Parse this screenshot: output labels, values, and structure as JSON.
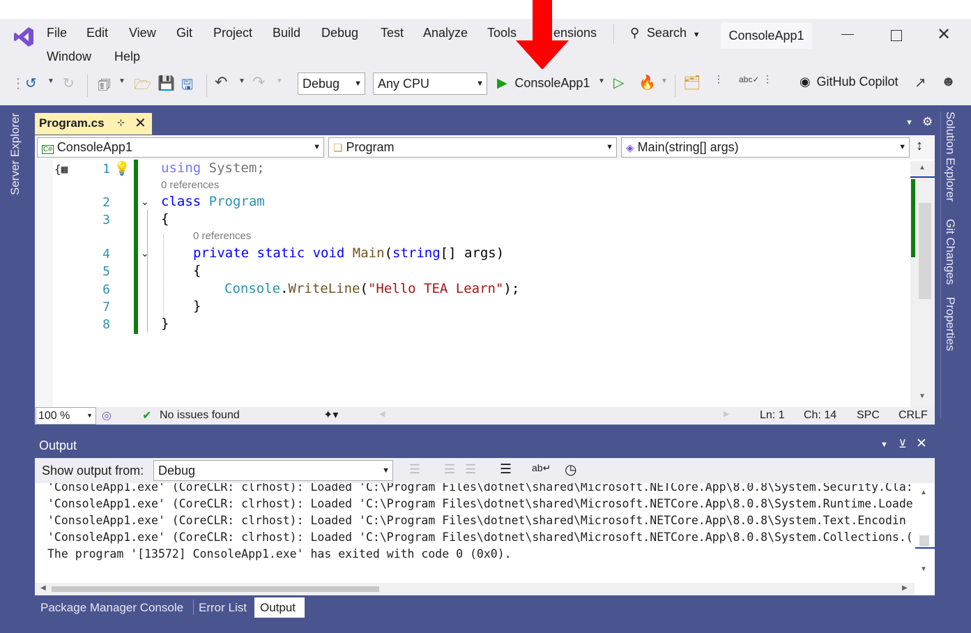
{
  "menu": {
    "items": [
      "File",
      "Edit",
      "View",
      "Git",
      "Project",
      "Build",
      "Debug",
      "Test",
      "Analyze",
      "Tools",
      "ensions",
      "Window",
      "Help"
    ],
    "search_label": "Search",
    "project_badge": "ConsoleApp1"
  },
  "toolbar": {
    "config": "Debug",
    "platform": "Any CPU",
    "run_target": "ConsoleApp1",
    "copilot": "GitHub Copilot"
  },
  "side_tabs": {
    "left": "Server Explorer",
    "right": [
      "Solution Explorer",
      "Git Changes",
      "Properties"
    ]
  },
  "editor": {
    "tab_title": "Program.cs",
    "nav_project": "ConsoleApp1",
    "nav_class": "Program",
    "nav_member": "Main(string[] args)",
    "line_numbers": [
      "1",
      "2",
      "3",
      "4",
      "5",
      "6",
      "7",
      "8"
    ],
    "refs_label": "0 references",
    "code": {
      "l1_kw": "using",
      "l1_rest": " System;",
      "l2_kw": "class",
      "l2_name": "Program",
      "l3": "{",
      "l4_kw": "private static void",
      "l4_fn": "Main",
      "l4_open": "(",
      "l4_kw2": "string",
      "l4_rest": "[] args)",
      "l5": "{",
      "l6_type": "Console",
      "l6_dot": ".",
      "l6_fn": "WriteLine",
      "l6_open": "(",
      "l6_str": "\"Hello TEA Learn\"",
      "l6_close": ");",
      "l7": "}",
      "l8": "}"
    }
  },
  "status": {
    "zoom": "100 %",
    "issues": "No issues found",
    "ln": "Ln: 1",
    "ch": "Ch: 14",
    "spc": "SPC",
    "crlf": "CRLF"
  },
  "output": {
    "title": "Output",
    "show_from_label": "Show output from:",
    "show_from_value": "Debug",
    "lines": [
      "'ConsoleApp1.exe' (CoreCLR: clrhost): Loaded 'C:\\Program Files\\dotnet\\shared\\Microsoft.NETCore.App\\8.0.8\\System.Security.Cla:",
      "'ConsoleApp1.exe' (CoreCLR: clrhost): Loaded 'C:\\Program Files\\dotnet\\shared\\Microsoft.NETCore.App\\8.0.8\\System.Runtime.Loade",
      "'ConsoleApp1.exe' (CoreCLR: clrhost): Loaded 'C:\\Program Files\\dotnet\\shared\\Microsoft.NETCore.App\\8.0.8\\System.Text.Encodin",
      "'ConsoleApp1.exe' (CoreCLR: clrhost): Loaded 'C:\\Program Files\\dotnet\\shared\\Microsoft.NETCore.App\\8.0.8\\System.Collections.(",
      "The program '[13572] ConsoleApp1.exe' has exited with code 0 (0x0)."
    ]
  },
  "bottom_tabs": [
    "Package Manager Console",
    "Error List",
    "Output"
  ],
  "colors": {
    "frame": "#4a5590",
    "accent_arrow": "#ff0000",
    "keyword": "#0000ff",
    "type": "#2b91af",
    "string": "#a31515",
    "change_bar": "#107c10"
  }
}
